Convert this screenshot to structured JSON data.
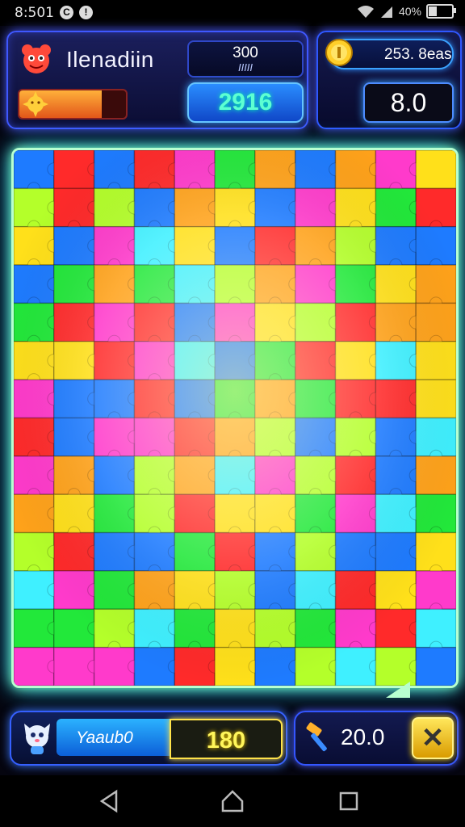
{
  "status_bar": {
    "time": "8:501",
    "battery_text": "40%",
    "battery_level": 0.4
  },
  "header": {
    "player_name": "Ilenadiin",
    "level_progress": 0.77,
    "target_top": "300",
    "target_sub": "IIIII",
    "score": "2916",
    "coins": "253. 8eas",
    "timer": "8.0"
  },
  "board": {
    "rows": 14,
    "cols": 11,
    "palette": [
      "#ff2a2a",
      "#ffe01a",
      "#22e83a",
      "#1e7bff",
      "#ff3acb",
      "#ffa21a",
      "#3ff0ff",
      "#b4ff2a"
    ]
  },
  "bottom": {
    "goal_label": "Yaaub0",
    "goal_value": "180",
    "tool_value": "20.0",
    "close_icon": "close-icon"
  },
  "nav": {
    "back": "back-icon",
    "home": "home-icon",
    "recents": "recents-icon"
  }
}
